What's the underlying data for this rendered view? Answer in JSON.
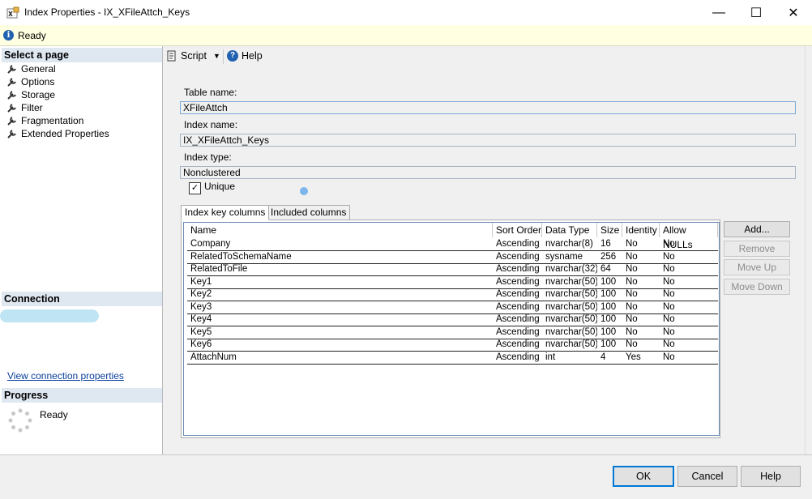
{
  "window": {
    "title": "Index Properties - IX_XFileAttch_Keys",
    "minimize_glyph": "—",
    "maximize_glyph": "☐",
    "close_glyph": "✕"
  },
  "status": {
    "text": "Ready",
    "icon": "info-icon"
  },
  "left_panel": {
    "select_page_title": "Select a page",
    "pages": [
      {
        "label": "General",
        "icon": "wrench-icon"
      },
      {
        "label": "Options",
        "icon": "wrench-icon"
      },
      {
        "label": "Storage",
        "icon": "wrench-icon"
      },
      {
        "label": "Filter",
        "icon": "wrench-icon"
      },
      {
        "label": "Fragmentation",
        "icon": "wrench-icon"
      },
      {
        "label": "Extended Properties",
        "icon": "wrench-icon"
      }
    ],
    "connection_title": "Connection",
    "view_connection_link": "View connection properties",
    "progress_title": "Progress",
    "progress_status": "Ready"
  },
  "toolbar": {
    "script_label": "Script",
    "help_label": "Help"
  },
  "form": {
    "table_name_label": "Table name:",
    "table_name_value": "XFileAttch",
    "index_name_label": "Index name:",
    "index_name_value": "IX_XFileAttch_Keys",
    "index_type_label": "Index type:",
    "index_type_value": "Nonclustered",
    "unique_label": "Unique",
    "unique_checked": true
  },
  "tabs": [
    {
      "label": "Index key columns",
      "active": true
    },
    {
      "label": "Included columns",
      "active": false
    }
  ],
  "grid": {
    "headers": [
      "Name",
      "Sort Order",
      "Data Type",
      "Size",
      "Identity",
      "Allow NULLs"
    ],
    "rows": [
      [
        "Company",
        "Ascending",
        "nvarchar(8)",
        "16",
        "No",
        "No"
      ],
      [
        "RelatedToSchemaName",
        "Ascending",
        "sysname",
        "256",
        "No",
        "No"
      ],
      [
        "RelatedToFile",
        "Ascending",
        "nvarchar(32)",
        "64",
        "No",
        "No"
      ],
      [
        "Key1",
        "Ascending",
        "nvarchar(50)",
        "100",
        "No",
        "No"
      ],
      [
        "Key2",
        "Ascending",
        "nvarchar(50)",
        "100",
        "No",
        "No"
      ],
      [
        "Key3",
        "Ascending",
        "nvarchar(50)",
        "100",
        "No",
        "No"
      ],
      [
        "Key4",
        "Ascending",
        "nvarchar(50)",
        "100",
        "No",
        "No"
      ],
      [
        "Key5",
        "Ascending",
        "nvarchar(50)",
        "100",
        "No",
        "No"
      ],
      [
        "Key6",
        "Ascending",
        "nvarchar(50)",
        "100",
        "No",
        "No"
      ],
      [
        "AttachNum",
        "Ascending",
        "int",
        "4",
        "Yes",
        "No"
      ]
    ]
  },
  "side_buttons": {
    "add": "Add...",
    "remove": "Remove",
    "move_up": "Move Up",
    "move_down": "Move Down"
  },
  "dialog_buttons": {
    "ok": "OK",
    "cancel": "Cancel",
    "help": "Help"
  }
}
